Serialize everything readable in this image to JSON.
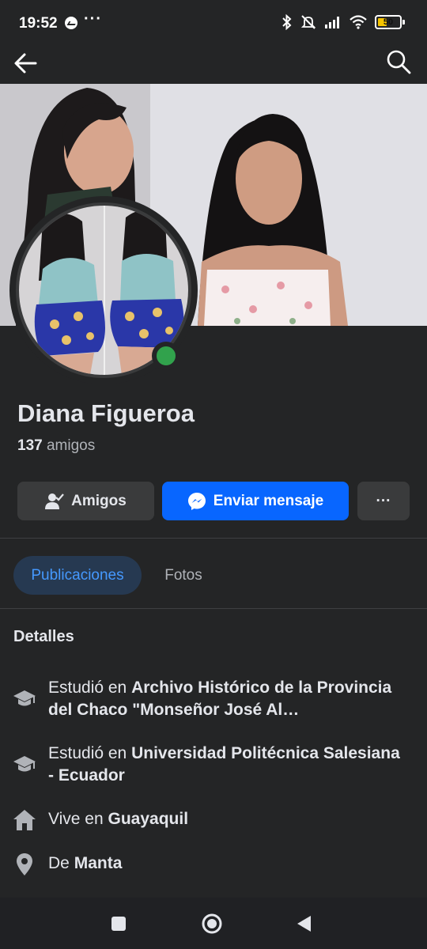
{
  "status_bar": {
    "time": "19:52",
    "overflow": "···",
    "battery_level": "50",
    "battery_color": "#f5c400",
    "icons": [
      "messenger-notification-icon",
      "bluetooth-icon",
      "mute-icon",
      "signal-icon",
      "wifi-icon",
      "battery-icon"
    ]
  },
  "top_bar": {
    "icons": [
      "back-arrow-icon",
      "search-icon"
    ]
  },
  "profile": {
    "name": "Diana Figueroa",
    "friend_count": "137",
    "friend_label": "amigos",
    "online": true,
    "online_color": "#31a24c"
  },
  "actions": {
    "friends_label": "Amigos",
    "message_label": "Enviar mensaje",
    "more_label": "···",
    "accent": "#0866ff"
  },
  "tabs": [
    {
      "label": "Publicaciones",
      "active": true
    },
    {
      "label": "Fotos",
      "active": false
    }
  ],
  "details": {
    "title": "Detalles",
    "items": [
      {
        "icon": "graduation-cap-icon",
        "prefix": "Estudió en",
        "value": "Archivo Histórico de la Provincia del Chaco \"Monseñor José Al…"
      },
      {
        "icon": "graduation-cap-icon",
        "prefix": "Estudió en",
        "value": "Universidad Politécnica Salesiana - Ecuador"
      },
      {
        "icon": "home-icon",
        "prefix": "Vive en",
        "value": "Guayaquil"
      },
      {
        "icon": "location-pin-icon",
        "prefix": "De",
        "value": "Manta"
      }
    ]
  },
  "nav_bar": {
    "icons": [
      "recents-icon",
      "home-circle-icon",
      "back-triangle-icon"
    ]
  }
}
